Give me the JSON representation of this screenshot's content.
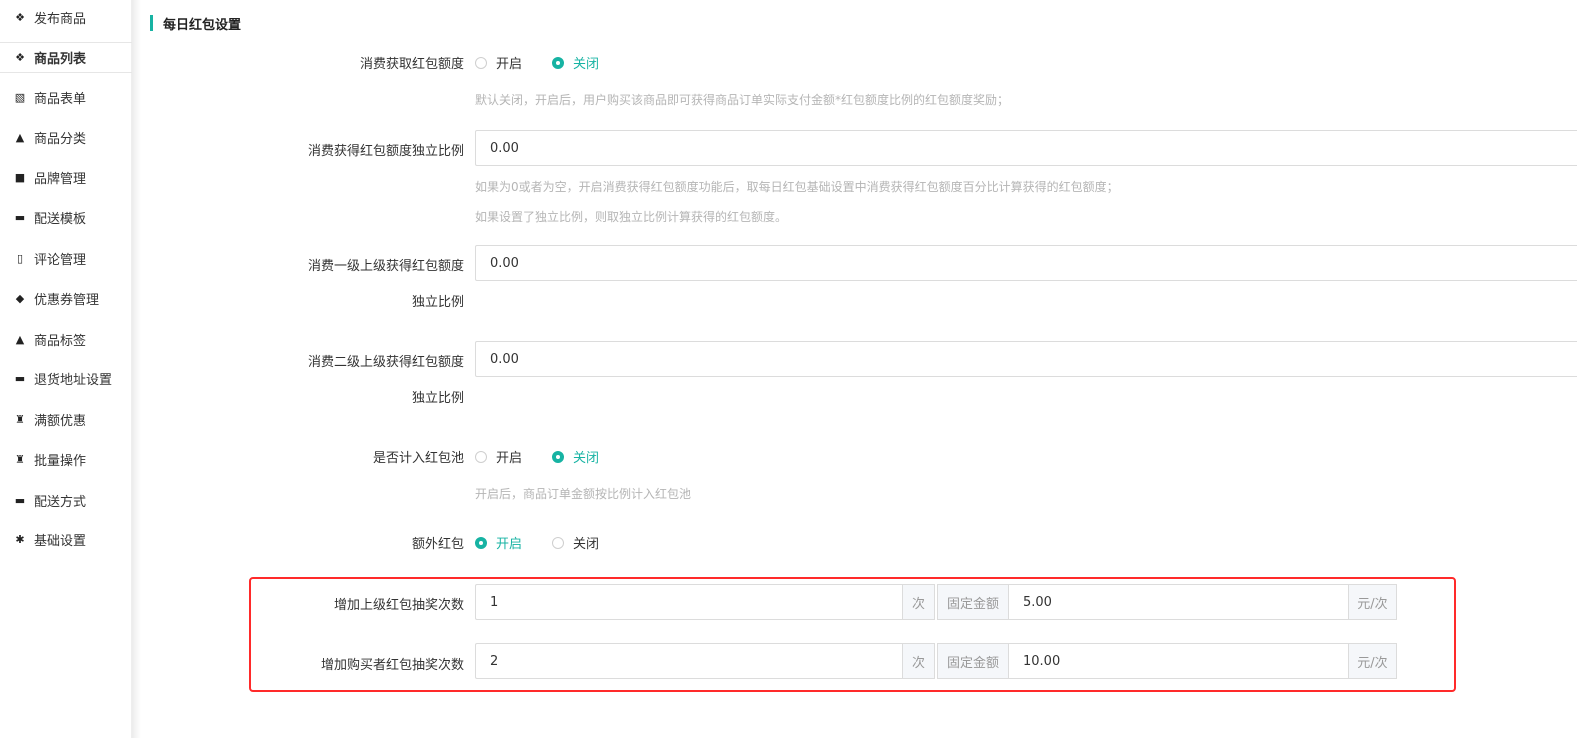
{
  "sidebar": {
    "items": [
      {
        "label": "发布商品",
        "icon": "cubes-icon"
      },
      {
        "label": "商品列表",
        "icon": "cubes-icon"
      },
      {
        "label": "商品表单",
        "icon": "excel-file-icon"
      },
      {
        "label": "商品分类",
        "icon": "sitemap-icon"
      },
      {
        "label": "品牌管理",
        "icon": "briefcase-icon"
      },
      {
        "label": "配送模板",
        "icon": "truck-icon"
      },
      {
        "label": "评论管理",
        "icon": "columns-icon"
      },
      {
        "label": "优惠券管理",
        "icon": "tags-icon"
      },
      {
        "label": "商品标签",
        "icon": "sitemap-icon"
      },
      {
        "label": "退货地址设置",
        "icon": "truck-icon"
      },
      {
        "label": "满额优惠",
        "icon": "gift-icon"
      },
      {
        "label": "批量操作",
        "icon": "gift-icon"
      },
      {
        "label": "配送方式",
        "icon": "truck-icon"
      },
      {
        "label": "基础设置",
        "icon": "gear-icon"
      }
    ]
  },
  "section": {
    "title": "每日红包设置",
    "accent": "#17b3a3"
  },
  "form": {
    "consume_quota": {
      "label": "消费获取红包额度",
      "options": [
        "开启",
        "关闭"
      ],
      "selected": "关闭",
      "hint": "默认关闭，开启后，用户购买该商品即可获得商品订单实际支付金额*红包额度比例的红包额度奖励；"
    },
    "independent_ratio": {
      "label": "消费获得红包额度独立比例",
      "value": "0.00",
      "hint1": "如果为0或者为空，开启消费获得红包额度功能后，取每日红包基础设置中消费获得红包额度百分比计算获得的红包额度；",
      "hint2": "如果设置了独立比例，则取独立比例计算获得的红包额度。"
    },
    "level1_ratio": {
      "label_line1": "消费一级上级获得红包额度",
      "label_line2": "独立比例",
      "value": "0.00"
    },
    "level2_ratio": {
      "label_line1": "消费二级上级获得红包额度",
      "label_line2": "独立比例",
      "value": "0.00"
    },
    "pool": {
      "label": "是否计入红包池",
      "options": [
        "开启",
        "关闭"
      ],
      "selected": "关闭",
      "hint": "开启后，商品订单金额按比例计入红包池"
    },
    "extra": {
      "label": "额外红包",
      "options": [
        "开启",
        "关闭"
      ],
      "selected": "开启"
    },
    "superior_draw": {
      "label": "增加上级红包抽奖次数",
      "count": "1",
      "count_unit": "次",
      "fixed_label": "固定金额",
      "amount": "5.00",
      "amount_unit": "元/次"
    },
    "buyer_draw": {
      "label": "增加购买者红包抽奖次数",
      "count": "2",
      "count_unit": "次",
      "fixed_label": "固定金额",
      "amount": "10.00",
      "amount_unit": "元/次"
    }
  },
  "colors": {
    "highlight": "#ff2a2a",
    "accent": "#17b3a3"
  }
}
